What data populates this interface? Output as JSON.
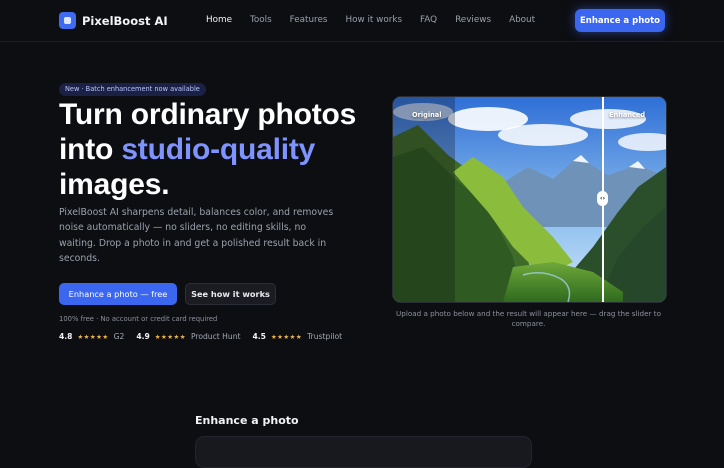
{
  "nav": {
    "brand": "PixelBoost AI",
    "links": [
      {
        "label": "Home",
        "active": true
      },
      {
        "label": "Tools",
        "active": false
      },
      {
        "label": "Features",
        "active": false
      },
      {
        "label": "How it works",
        "active": false
      },
      {
        "label": "FAQ",
        "active": false
      },
      {
        "label": "Reviews",
        "active": false
      },
      {
        "label": "About",
        "active": false
      }
    ],
    "cta_label": "Enhance a photo"
  },
  "hero": {
    "badge": "New · Batch enhancement now available",
    "headline_line1": "Turn ordinary photos",
    "headline_line2_prefix": "into ",
    "headline_accent": "studio-quality",
    "headline_line3": "images.",
    "description": "PixelBoost AI sharpens detail, balances color, and removes noise automatically — no sliders, no editing skills, no waiting. Drop a photo in and get a polished result back in seconds.",
    "primary_cta": "Enhance a photo — free",
    "secondary_cta": "See how it works",
    "note": "100% free · No account or credit card required",
    "ratings": [
      {
        "score": "4.8",
        "stars": "★★★★★",
        "source": "G2"
      },
      {
        "score": "4.9",
        "stars": "★★★★★",
        "source": "Product Hunt"
      },
      {
        "score": "4.5",
        "stars": "★★★★★",
        "source": "Trustpilot"
      }
    ]
  },
  "comparison": {
    "label_before": "Original",
    "label_after": "Enhanced",
    "slider_position": 0.765,
    "handle_glyph": "‹›",
    "caption": "Upload a photo below and the result will appear here — drag the slider to compare."
  },
  "enhance_section": {
    "title": "Enhance a photo"
  },
  "colors": {
    "accent": "#3a66f0",
    "accent_text": "#7f93ff",
    "background": "#0d0e12",
    "stars": "#f1b64a"
  }
}
